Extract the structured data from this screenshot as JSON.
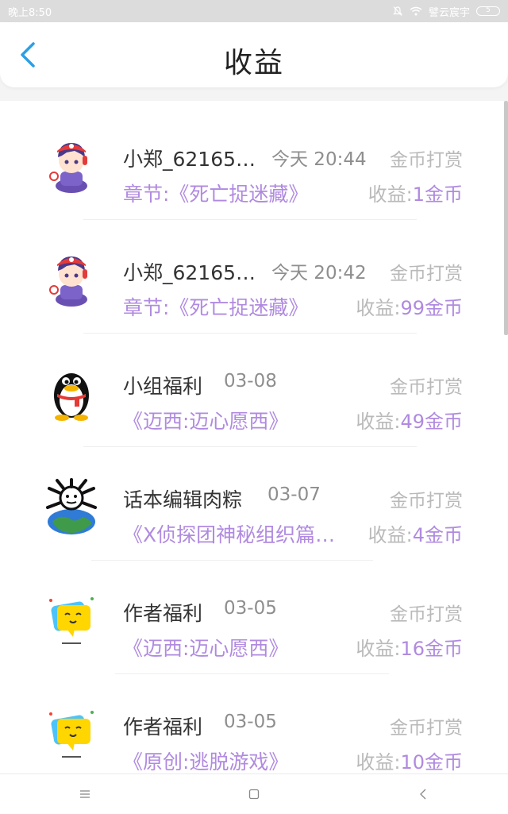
{
  "status_bar": {
    "time": "晚上8:50",
    "carrier": "譬云宸宇",
    "battery": "5"
  },
  "header": {
    "title": "收益"
  },
  "items": [
    {
      "name": "小郑_62165…",
      "time": "今天 20:44",
      "type": "金币打赏",
      "chapter": "章节:《死亡捉迷藏》",
      "income_label": "收益:",
      "income_value": "1金币",
      "avatar": "anime-avatar"
    },
    {
      "name": "小郑_62165…",
      "time": "今天 20:42",
      "type": "金币打赏",
      "chapter": "章节:《死亡捉迷藏》",
      "income_label": "收益:",
      "income_value": "99金币",
      "avatar": "anime-avatar"
    },
    {
      "name": "小组福利",
      "time": "03-08",
      "type": "金币打赏",
      "chapter": "《迈西:迈心愿西》",
      "income_label": "收益:",
      "income_value": "49金币",
      "avatar": "penguin-avatar"
    },
    {
      "name": "话本编辑肉粽",
      "time": "03-07",
      "type": "金币打赏",
      "chapter": "《X侦探团神秘组织篇…",
      "income_label": "收益:",
      "income_value": "4金币",
      "avatar": "earth-avatar"
    },
    {
      "name": "作者福利",
      "time": "03-05",
      "type": "金币打赏",
      "chapter": "《迈西:迈心愿西》",
      "income_label": "收益:",
      "income_value": "16金币",
      "avatar": "chat-bubble-avatar"
    },
    {
      "name": "作者福利",
      "time": "03-05",
      "type": "金币打赏",
      "chapter": "《原创:逃脱游戏》",
      "income_label": "收益:",
      "income_value": "10金币",
      "avatar": "chat-bubble-avatar"
    }
  ],
  "colors": {
    "accent": "#2b9fe6",
    "purple": "#b08ae0",
    "gray": "#b9b9b9"
  }
}
